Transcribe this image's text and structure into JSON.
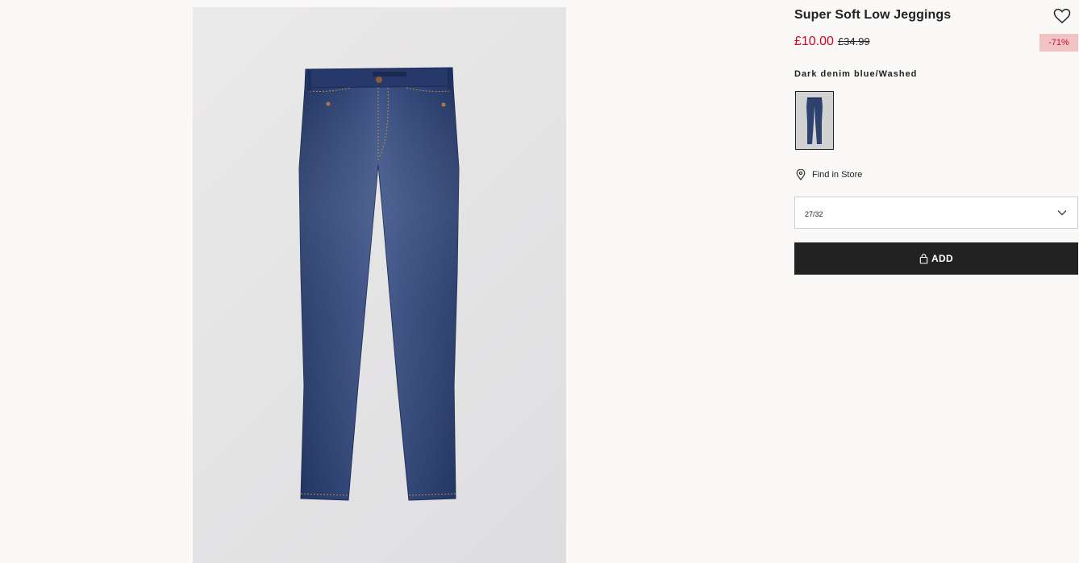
{
  "product": {
    "title": "Super Soft Low Jeggings",
    "price_current": "£10.00",
    "price_original": "£34.99",
    "discount": "-71%",
    "color_name": "Dark denim blue/Washed"
  },
  "store": {
    "find_label": "Find in Store"
  },
  "size": {
    "selected": "27/32"
  },
  "cart": {
    "add_label": "ADD"
  },
  "icons": {
    "favorite": "heart-icon",
    "store": "location-pin-icon",
    "dropdown": "chevron-down-icon",
    "bag": "shopping-bag-icon"
  },
  "colors": {
    "sale": "#d6001c",
    "discount_bg": "#f1c3c5",
    "button_bg": "#222222",
    "denim": "#2b3f6e"
  }
}
